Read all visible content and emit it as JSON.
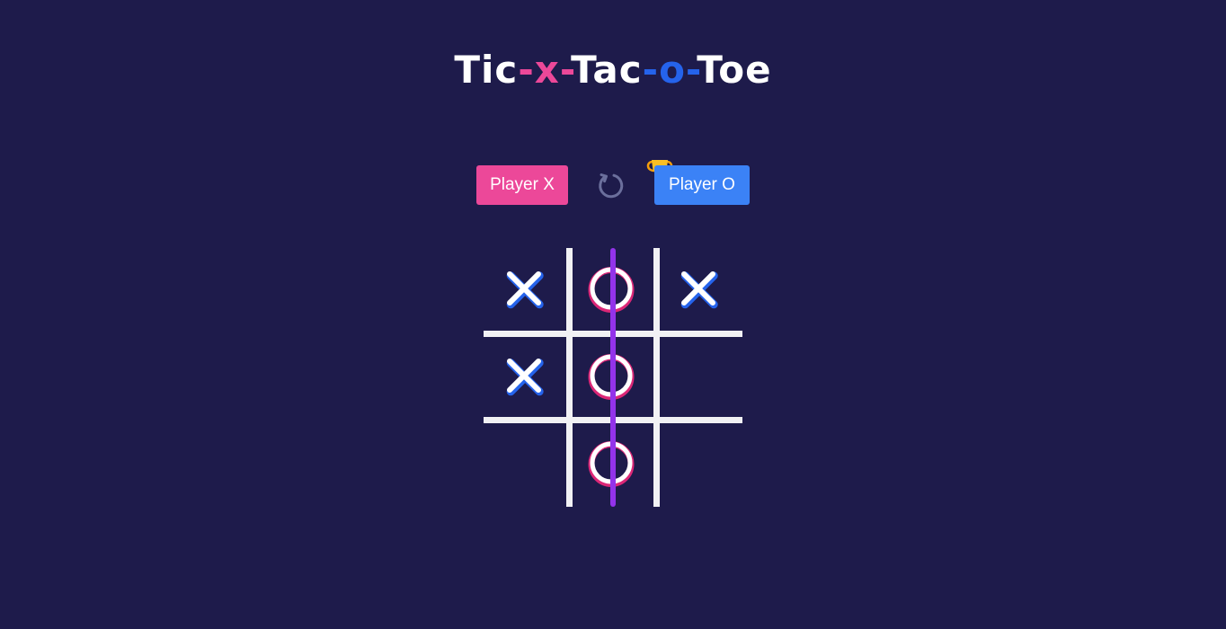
{
  "title": {
    "part1": "Tic",
    "sep1": "-",
    "x": "x",
    "sep2": "-",
    "part2": "Tac",
    "sep3": "-",
    "o": "o",
    "sep4": "-",
    "part3": "Toe"
  },
  "players": {
    "x_label": "Player X",
    "o_label": "Player O",
    "winner": "o"
  },
  "icons": {
    "reset": "reset-icon",
    "trophy": "trophy-icon"
  },
  "board": {
    "cells": [
      "X",
      "O",
      "X",
      "X",
      "O",
      "",
      "",
      "O",
      ""
    ],
    "winning_line": "column-2"
  },
  "colors": {
    "background": "#1e1b4b",
    "player_x": "#ec4899",
    "player_o": "#3b82f6",
    "x_mark_glow": "#2563eb",
    "o_mark_glow": "#db2777",
    "win_line": "#9333ea",
    "grid": "#f1f1f4"
  }
}
